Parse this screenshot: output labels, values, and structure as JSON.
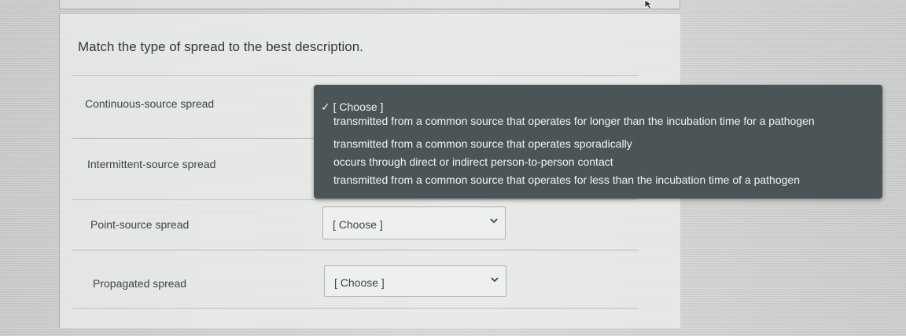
{
  "question": {
    "prompt": "Match the type of spread to the best description."
  },
  "rows": [
    {
      "label": "Continuous-source spread",
      "selected": "[ Choose ]"
    },
    {
      "label": "Intermittent-source spread",
      "selected": ""
    },
    {
      "label": "Point-source spread",
      "selected": "[ Choose ]"
    },
    {
      "label": "Propagated spread",
      "selected": "[ Choose ]"
    }
  ],
  "dropdown": {
    "selected_label": "✓ [ Choose ]",
    "options": [
      "transmitted from a common source that operates for longer than the incubation time for a pathogen",
      "transmitted from a common source that operates sporadically",
      "occurs through direct or indirect person-to-person contact",
      "transmitted from a common source that operates for less than the incubation time of a pathogen"
    ]
  },
  "icons": {
    "chevron": "chevron-down-icon",
    "cursor": "mouse-pointer-icon"
  }
}
